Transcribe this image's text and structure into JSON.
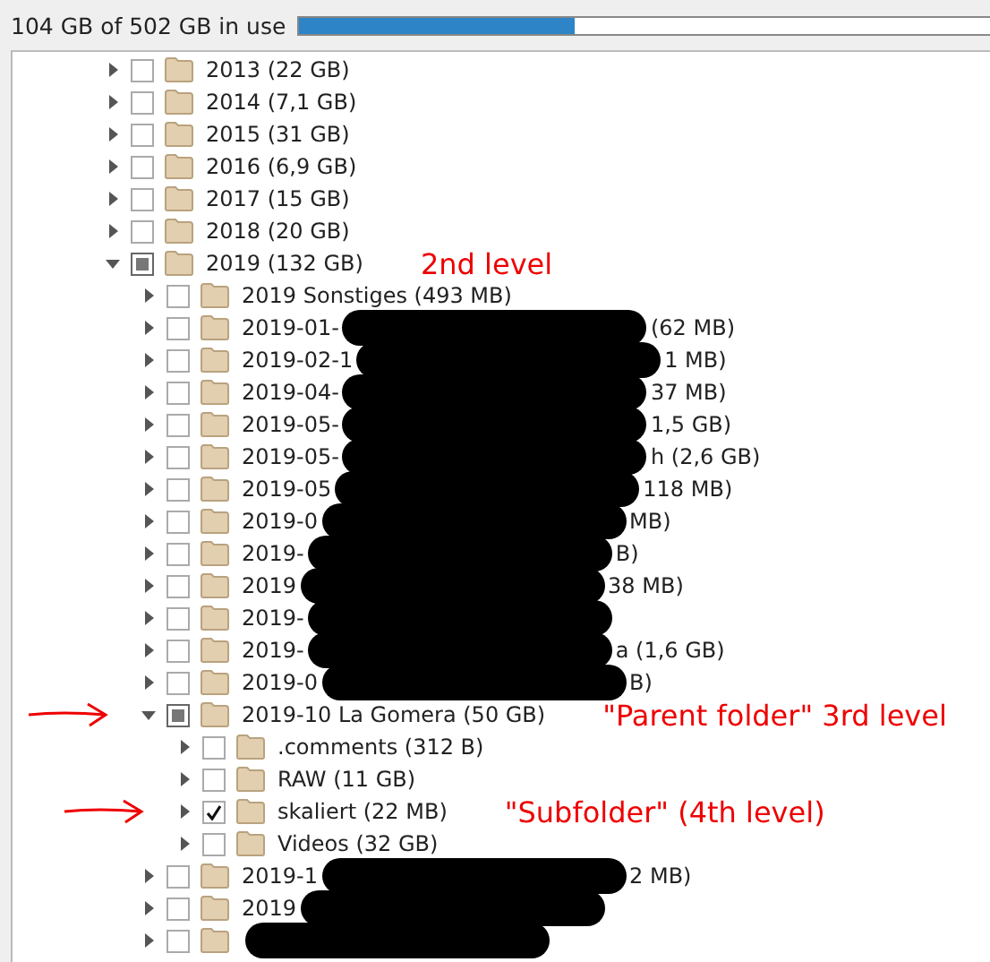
{
  "usage": {
    "label": "104 GB of 502 GB in use",
    "level": 0.4
  },
  "tree": [
    {
      "label": "2013 (22 GB)",
      "expanded": false,
      "checked": false,
      "mixed": false
    },
    {
      "label": "2014 (7,1 GB)",
      "expanded": false,
      "checked": false,
      "mixed": false
    },
    {
      "label": "2015 (31 GB)",
      "expanded": false,
      "checked": false,
      "mixed": false
    },
    {
      "label": "2016 (6,9 GB)",
      "expanded": false,
      "checked": false,
      "mixed": false
    },
    {
      "label": "2017 (15 GB)",
      "expanded": false,
      "checked": false,
      "mixed": false
    },
    {
      "label": "2018 (20 GB)",
      "expanded": false,
      "checked": false,
      "mixed": false
    },
    {
      "label": "2019 (132 GB)",
      "expanded": true,
      "checked": false,
      "mixed": true,
      "note": "2nd level",
      "children": [
        {
          "label": "2019 Sonstiges (493 MB)",
          "expanded": false,
          "checked": false,
          "mixed": false
        },
        {
          "label": "2019-01-",
          "redacted": true,
          "label_end": "(62 MB)",
          "expanded": false,
          "checked": false,
          "mixed": false
        },
        {
          "label": "2019-02-1",
          "redacted": true,
          "label_end": "1 MB)",
          "expanded": false,
          "checked": false,
          "mixed": false
        },
        {
          "label": "2019-04-",
          "redacted": true,
          "label_end": "37 MB)",
          "expanded": false,
          "checked": false,
          "mixed": false
        },
        {
          "label": "2019-05-",
          "redacted": true,
          "label_end": "1,5 GB)",
          "expanded": false,
          "checked": false,
          "mixed": false
        },
        {
          "label": "2019-05-",
          "redacted": true,
          "label_end": "h (2,6 GB)",
          "expanded": false,
          "checked": false,
          "mixed": false
        },
        {
          "label": "2019-05",
          "redacted": true,
          "label_end": "118 MB)",
          "expanded": false,
          "checked": false,
          "mixed": false
        },
        {
          "label": "2019-0",
          "redacted": true,
          "label_end": "MB)",
          "expanded": false,
          "checked": false,
          "mixed": false
        },
        {
          "label": "2019-",
          "redacted": true,
          "label_end": "B)",
          "expanded": false,
          "checked": false,
          "mixed": false
        },
        {
          "label": "2019",
          "redacted": true,
          "label_end": "38 MB)",
          "expanded": false,
          "checked": false,
          "mixed": false
        },
        {
          "label": "2019-",
          "redacted": true,
          "expanded": false,
          "checked": false,
          "mixed": false
        },
        {
          "label": "2019-",
          "redacted": true,
          "label_end": "a (1,6 GB)",
          "expanded": false,
          "checked": false,
          "mixed": false
        },
        {
          "label": "2019-0",
          "redacted": true,
          "label_end": "B)",
          "expanded": false,
          "checked": false,
          "mixed": false
        },
        {
          "label": "2019-10 La Gomera (50 GB)",
          "expanded": true,
          "checked": false,
          "mixed": true,
          "note": "\"Parent folder\" 3rd level",
          "arrow": true,
          "children": [
            {
              "label": ".comments (312 B)",
              "expanded": false,
              "checked": false,
              "mixed": false
            },
            {
              "label": "RAW (11 GB)",
              "expanded": false,
              "checked": false,
              "mixed": false
            },
            {
              "label": "skaliert (22 MB)",
              "expanded": false,
              "checked": true,
              "mixed": false,
              "note": "\"Subfolder\" (4th level)",
              "arrow": true
            },
            {
              "label": "Videos (32 GB)",
              "expanded": false,
              "checked": false,
              "mixed": false
            }
          ]
        },
        {
          "label": "2019-1",
          "redacted": true,
          "label_end": "2 MB)",
          "expanded": false,
          "checked": false,
          "mixed": false
        },
        {
          "label": "2019",
          "redacted": true,
          "expanded": false,
          "checked": false,
          "mixed": false
        },
        {
          "redacted": true,
          "expanded": false,
          "checked": false,
          "mixed": false
        }
      ]
    }
  ]
}
